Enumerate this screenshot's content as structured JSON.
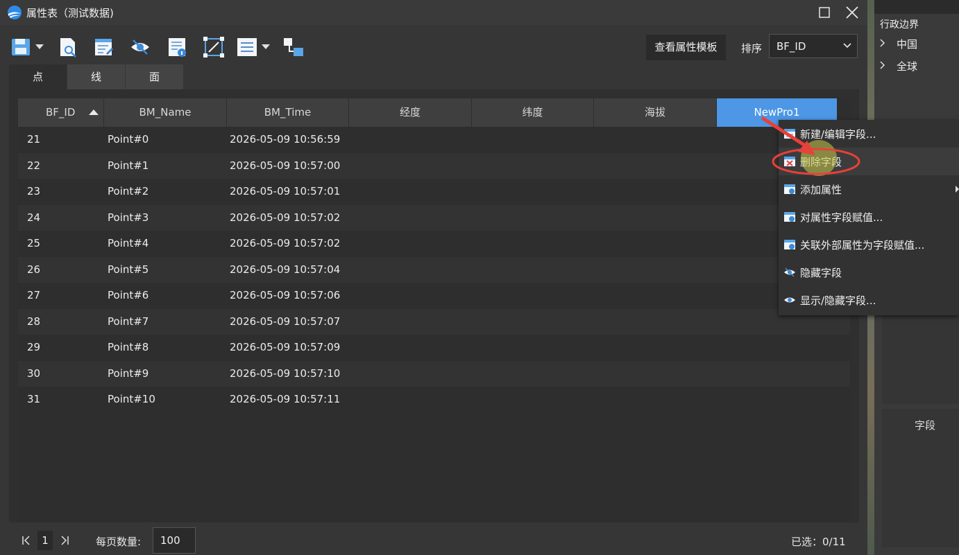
{
  "window": {
    "title": "属性表（测试数据)"
  },
  "toolbar": {
    "icons": [
      "save-icon",
      "document-search-icon",
      "edit-table-icon",
      "hide-eye-icon",
      "document-info-icon",
      "select-frame-icon",
      "list-view-icon",
      "linked-windows-icon"
    ],
    "template_button": "查看属性模板",
    "sort_label": "排序",
    "sort_value": "BF_ID"
  },
  "tabs": [
    {
      "label": "点",
      "active": true
    },
    {
      "label": "线",
      "active": false
    },
    {
      "label": "面",
      "active": false
    }
  ],
  "table": {
    "columns": [
      "BF_ID",
      "BM_Name",
      "BM_Time",
      "经度",
      "纬度",
      "海拔",
      "NewPro1"
    ],
    "selected_column": "NewPro1",
    "sort_column": "BF_ID",
    "sort_direction": "ascending",
    "rows": [
      {
        "id": "21",
        "name": "Point#0",
        "time": "2026-05-09 10:56:59"
      },
      {
        "id": "22",
        "name": "Point#1",
        "time": "2026-05-09 10:57:00"
      },
      {
        "id": "23",
        "name": "Point#2",
        "time": "2026-05-09 10:57:01"
      },
      {
        "id": "24",
        "name": "Point#3",
        "time": "2026-05-09 10:57:02"
      },
      {
        "id": "25",
        "name": "Point#4",
        "time": "2026-05-09 10:57:02"
      },
      {
        "id": "26",
        "name": "Point#5",
        "time": "2026-05-09 10:57:04"
      },
      {
        "id": "27",
        "name": "Point#6",
        "time": "2026-05-09 10:57:06"
      },
      {
        "id": "28",
        "name": "Point#7",
        "time": "2026-05-09 10:57:07"
      },
      {
        "id": "29",
        "name": "Point#8",
        "time": "2026-05-09 10:57:09"
      },
      {
        "id": "30",
        "name": "Point#9",
        "time": "2026-05-09 10:57:10"
      },
      {
        "id": "31",
        "name": "Point#10",
        "time": "2026-05-09 10:57:11"
      }
    ]
  },
  "footer": {
    "page": "1",
    "page_size_label": "每页数量:",
    "page_size": "100",
    "selected": "已选：0/11"
  },
  "context_menu": {
    "items": [
      {
        "label": "新建/编辑字段...",
        "icon": "edit-field-icon"
      },
      {
        "label": "删除字段",
        "icon": "delete-field-icon",
        "highlighted": true
      },
      {
        "label": "添加属性",
        "icon": "add-attribute-icon",
        "submenu": true
      },
      {
        "label": "对属性字段赋值...",
        "icon": "assign-value-icon"
      },
      {
        "label": "关联外部属性为字段赋值...",
        "icon": "link-external-icon"
      },
      {
        "label": "隐藏字段",
        "icon": "hide-eye-icon"
      },
      {
        "label": "显示/隐藏字段...",
        "icon": "show-eye-icon"
      }
    ]
  },
  "right_panel": {
    "title": "行政边界",
    "items": [
      "中国",
      "全球"
    ],
    "field_header": "字段"
  },
  "colors": {
    "accent": "#4d97e6",
    "annotation_red": "#e8403a",
    "highlight_yellow": "#c8c84a"
  }
}
